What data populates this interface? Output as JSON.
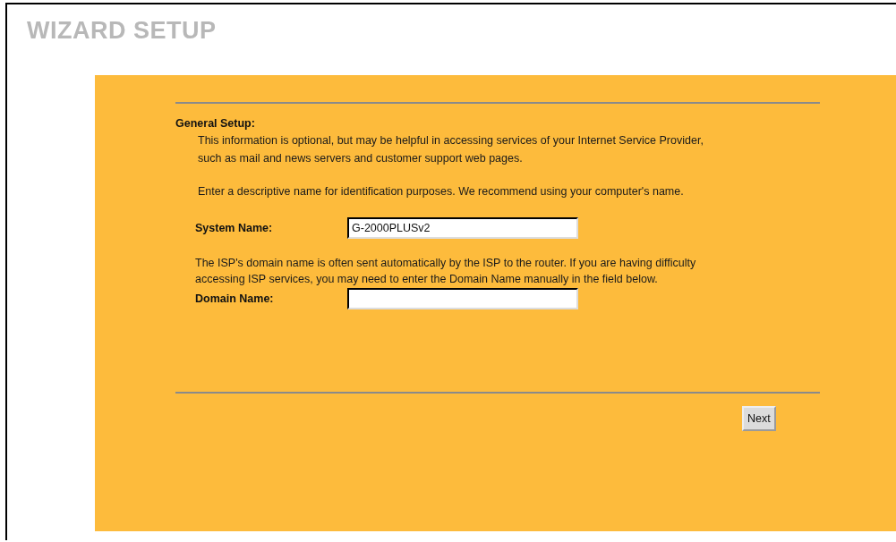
{
  "title": "WIZARD SETUP",
  "section": {
    "heading": "General Setup:",
    "paragraphs": [
      "This information is optional, but may be helpful in accessing services of your Internet Service Provider, such as mail and news servers and customer support web pages.",
      "Enter a descriptive name for identification purposes. We recommend using your computer's name."
    ]
  },
  "system_name": {
    "label": "System Name:",
    "value": "G-2000PLUSv2"
  },
  "domain_note": "The ISP's domain name is often sent automatically by the ISP to the router. If you are having difficulty accessing ISP services, you may need to enter the Domain Name manually in the field below.",
  "domain_name": {
    "label": "Domain Name:"
  },
  "buttons": [
    "Next"
  ]
}
